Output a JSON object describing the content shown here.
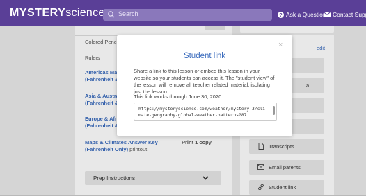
{
  "header": {
    "logo_bold": "MYSTERY",
    "logo_light": "science",
    "search_placeholder": "Search",
    "ask_label": "Ask a Question",
    "contact_label": "Contact Support"
  },
  "materials": {
    "colored_pencils": "Colored Pencils",
    "rulers": "Rulers",
    "americas_line1": "Americas Map",
    "americas_line2": "(Fahrenheit & ",
    "asia_line1": "Asia & Austral",
    "asia_line2": "(Fahrenheit & ",
    "europe_line1": "Europe & Afric",
    "europe_line2": "(Fahrenheit & ",
    "answer_key_line1": "Maps & Climates Answer Key",
    "answer_key_line2_bold": "(Fahrenheit Only)",
    "answer_key_line2_rest": " printout",
    "answer_key_qty": "Print 1 copy",
    "prep_label": "Prep Instructions"
  },
  "sidebar": {
    "edit_label": "edit",
    "partial_label": "a",
    "transcripts_label": "Transcripts",
    "email_parents_label": "Email parents",
    "student_link_label": "Student link"
  },
  "modal": {
    "close_glyph": "×",
    "title": "Student link",
    "description": "Share a link to this lesson or embed this lesson in your website so your students can access it. The \"student view\" of the lesson will remove all teacher related material, isolating just the lesson.",
    "expiry": "This link works through June 30, 2020.",
    "url_text": "https://mysteryscience.com/weather/mystery-3/climate-geography-global-weather-patterns?87"
  },
  "colors": {
    "header": "#5a3f97",
    "link": "#3a6bbd"
  }
}
